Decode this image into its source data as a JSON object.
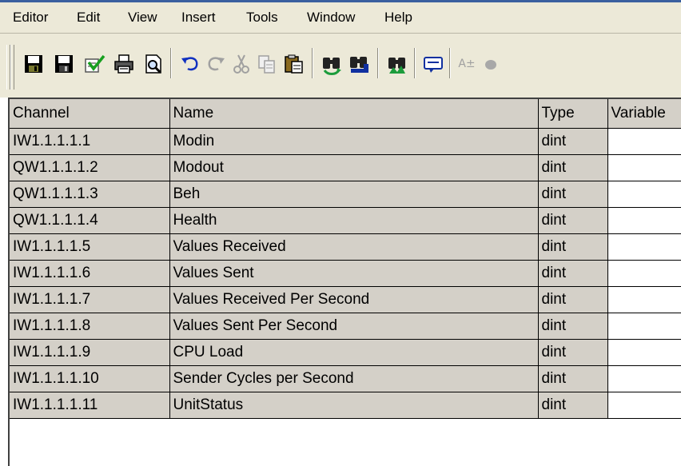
{
  "menu": {
    "items": [
      "Editor",
      "Edit",
      "View",
      "Insert",
      "Tools",
      "Window",
      "Help"
    ]
  },
  "toolbar": {
    "buttons": [
      "save-as-icon",
      "save-icon",
      "check-icon",
      "print-icon",
      "print-preview-icon",
      "undo-icon",
      "redo-icon",
      "cut-icon",
      "copy-icon",
      "paste-icon",
      "find-icon",
      "find-replace-icon",
      "find-next-icon",
      "comment-icon",
      "text-format-icon",
      "bullet-icon"
    ],
    "text_format_label": "A±"
  },
  "grid": {
    "columns": [
      "Channel",
      "Name",
      "Type",
      "Variable"
    ],
    "rows": [
      {
        "channel": "IW1.1.1.1.1",
        "name": "Modin",
        "type": "dint",
        "variable": ""
      },
      {
        "channel": "QW1.1.1.1.2",
        "name": "Modout",
        "type": "dint",
        "variable": ""
      },
      {
        "channel": "QW1.1.1.1.3",
        "name": "Beh",
        "type": "dint",
        "variable": ""
      },
      {
        "channel": "QW1.1.1.1.4",
        "name": "Health",
        "type": "dint",
        "variable": ""
      },
      {
        "channel": "IW1.1.1.1.5",
        "name": "Values Received",
        "type": "dint",
        "variable": ""
      },
      {
        "channel": "IW1.1.1.1.6",
        "name": "Values Sent",
        "type": "dint",
        "variable": ""
      },
      {
        "channel": "IW1.1.1.1.7",
        "name": "Values Received Per Second",
        "type": "dint",
        "variable": ""
      },
      {
        "channel": "IW1.1.1.1.8",
        "name": "Values Sent Per Second",
        "type": "dint",
        "variable": ""
      },
      {
        "channel": "IW1.1.1.1.9",
        "name": "CPU Load",
        "type": "dint",
        "variable": ""
      },
      {
        "channel": "IW1.1.1.1.10",
        "name": "Sender Cycles per Second",
        "type": "dint",
        "variable": ""
      },
      {
        "channel": "IW1.1.1.1.11",
        "name": "UnitStatus",
        "type": "dint",
        "variable": ""
      }
    ]
  }
}
